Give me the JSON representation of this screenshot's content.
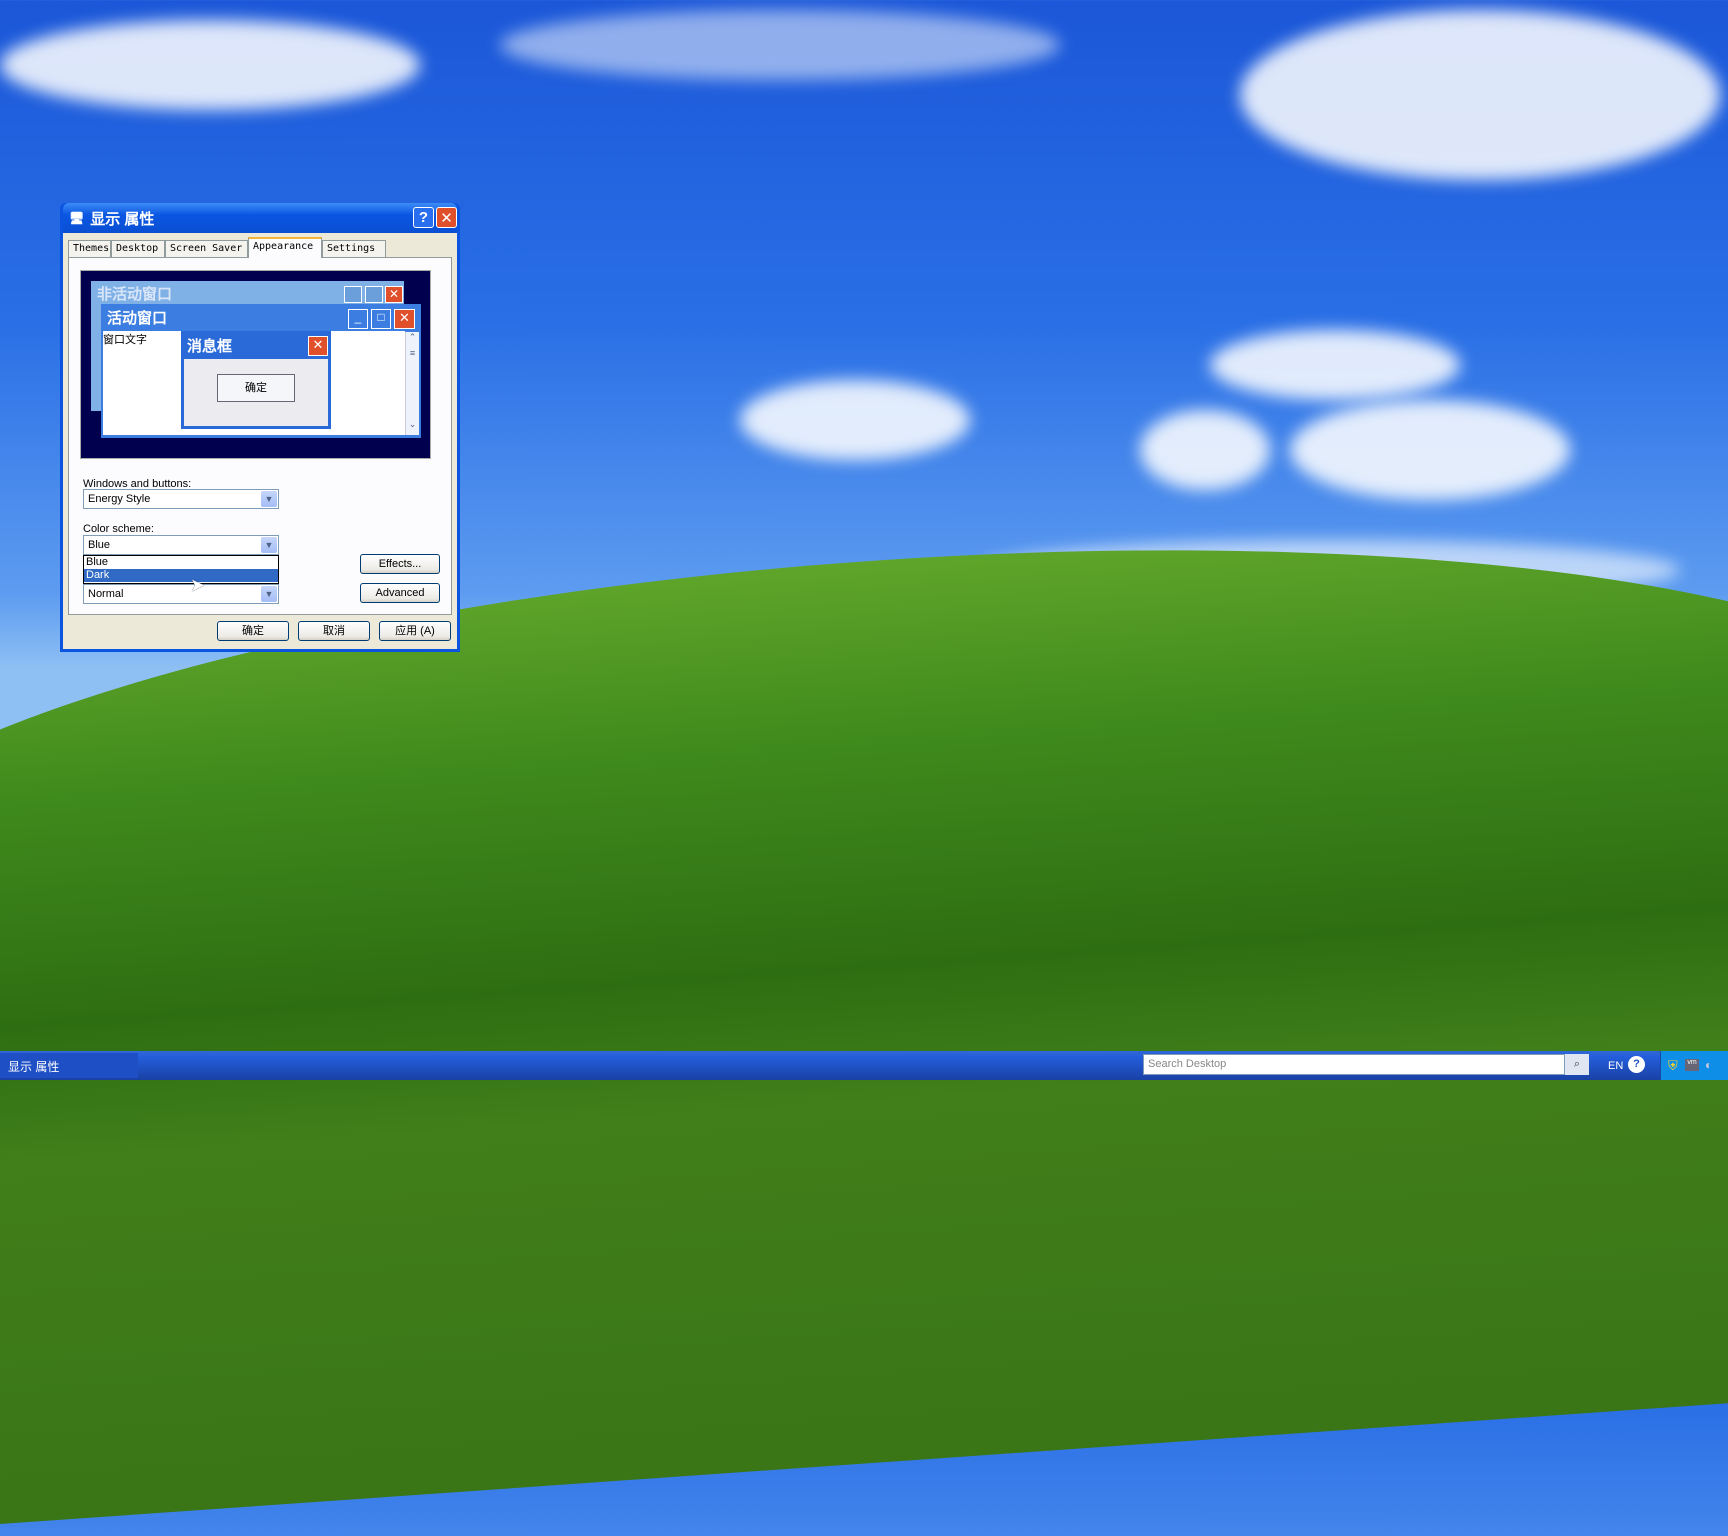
{
  "dialog": {
    "title": "显示 属性",
    "help": "?",
    "close": "✕",
    "tabs": [
      "Themes",
      "Desktop",
      "Screen Saver",
      "Appearance",
      "Settings"
    ],
    "selected_tab": "Appearance",
    "preview": {
      "inactive_title": "非活动窗口",
      "active_title": "活动窗口",
      "window_text": "窗口文字",
      "message_title": "消息框",
      "message_ok": "确定"
    },
    "windows_buttons_label": "Windows and buttons:",
    "windows_buttons_value": "Energy Style",
    "color_scheme_label": "Color scheme:",
    "color_scheme_value": "Blue",
    "color_scheme_options": [
      "Blue",
      "Dark"
    ],
    "highlighted_option": "Dark",
    "font_size_value": "Normal",
    "effects": "Effects...",
    "advanced": "Advanced",
    "ok": "确定",
    "cancel": "取消",
    "apply": "应用 (A)"
  },
  "taskbar": {
    "task": "显示 属性",
    "search_placeholder": "Search Desktop",
    "lang": "EN"
  },
  "colors": {
    "xp_blue": "#0a54e0",
    "close_red": "#e0502a",
    "highlight": "#316ac5"
  }
}
